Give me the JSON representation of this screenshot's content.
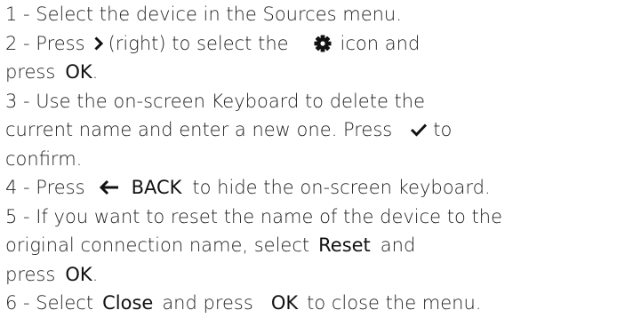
{
  "steps": [
    {
      "n": "1 - ",
      "line1": "Select the device in the Sources menu."
    },
    {
      "n": "2 - ",
      "a": "Press",
      "a_key": "(right) to select the",
      "a_end": "icon and",
      "b_pre": "press",
      "b_key": "OK",
      "b_end": "."
    },
    {
      "n": "3 - ",
      "line1": "Use the on-screen Keyboard to delete the",
      "line2_pre": "current name and enter a new one. Press",
      "line2_end": "to",
      "line3": "confirm."
    },
    {
      "n": "4 - ",
      "pre": "Press",
      "key": "BACK",
      "end": "to hide the on-screen keyboard."
    },
    {
      "n": "5 - ",
      "line1": "If you want to reset the name of the device to the",
      "line2_pre": "original connection name, select",
      "line2_key": "Reset",
      "line2_end": "and",
      "line3_pre": "press",
      "line3_key": "OK",
      "line3_end": "."
    },
    {
      "n": "6 - ",
      "pre": "Select",
      "key1": "Close",
      "mid": "and press",
      "key2": "OK",
      "end": "to close the menu."
    }
  ],
  "icons": {
    "right": "chevron-right-icon",
    "settings": "gear-icon",
    "confirm": "checkmark-icon",
    "back": "arrow-left-icon"
  }
}
